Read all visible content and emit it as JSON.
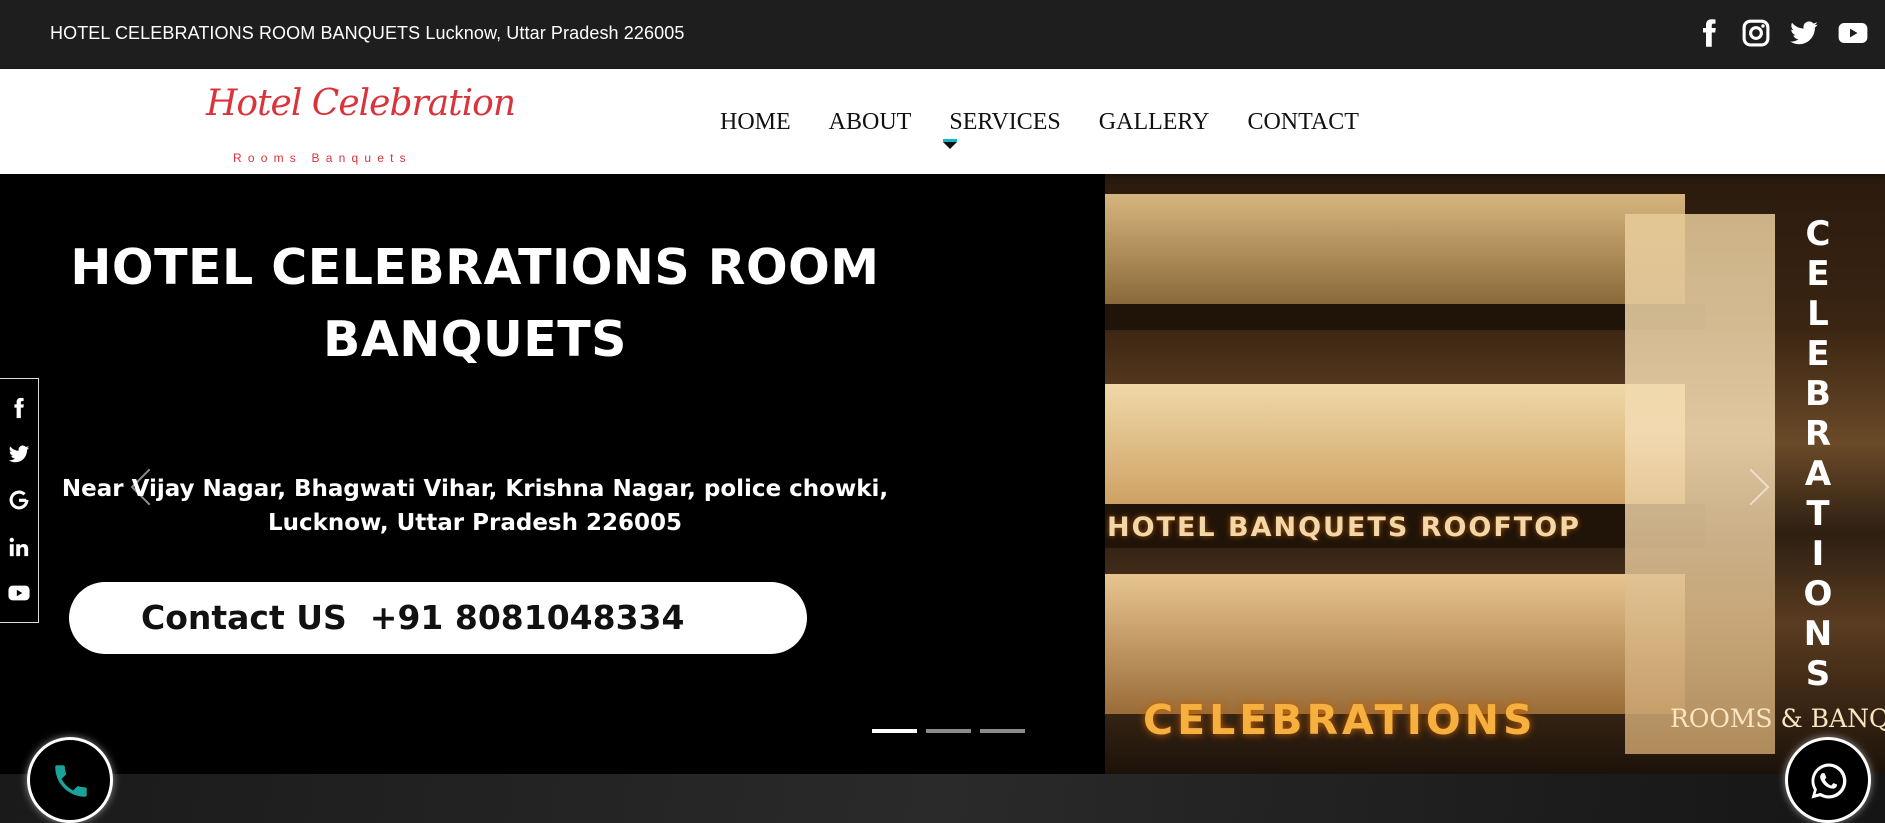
{
  "topbar": {
    "address": "HOTEL CELEBRATIONS ROOM BANQUETS Lucknow, Uttar Pradesh 226005",
    "socials": [
      "facebook-icon",
      "instagram-icon",
      "twitter-icon",
      "youtube-icon"
    ]
  },
  "logo": {
    "script": "Hotel Celebration",
    "tagline": "Rooms Banquets",
    "color": "#d9343b"
  },
  "nav": {
    "items": [
      {
        "label": "HOME"
      },
      {
        "label": "ABOUT"
      },
      {
        "label": "SERVICES"
      },
      {
        "label": "GALLERY"
      },
      {
        "label": "CONTACT"
      }
    ]
  },
  "hero": {
    "title": "HOTEL CELEBRATIONS ROOM BANQUETS",
    "address": "Near Vijay Nagar, Bhagwati Vihar, Krishna Nagar, police chowki, Lucknow, Uttar Pradesh 226005",
    "contact": "Contact US  +91 8081048334",
    "image_signs": {
      "banner": "HOTEL BANQUETS ROOFTOP",
      "main": "CELEBRATIONS",
      "secondary": "ROOMS & BANQUE",
      "vertical": "CELEBRATIONS"
    },
    "slides_total": 3,
    "active_slide": 1
  },
  "sidebar": {
    "icons": [
      "facebook-icon",
      "twitter-icon",
      "google-icon",
      "linkedin-icon",
      "youtube-icon"
    ]
  },
  "floating": {
    "phone_color": "#1aa39a",
    "whatsapp_color": "#ffffff"
  }
}
